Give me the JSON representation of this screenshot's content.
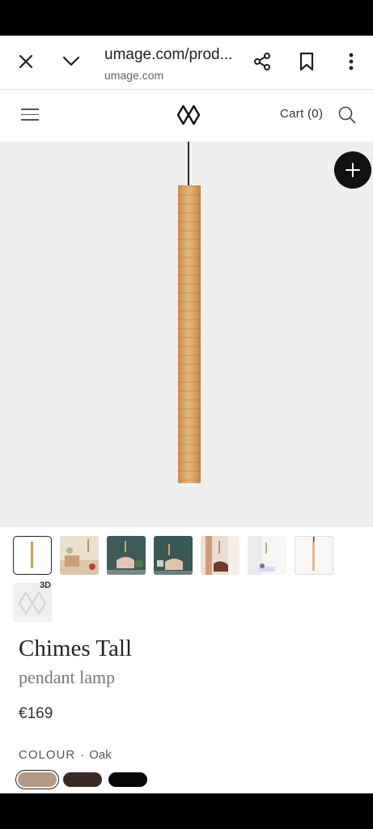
{
  "browser": {
    "url_main": "umage.com/prod...",
    "url_domain": "umage.com",
    "icons": [
      "close-icon",
      "chevron-down-icon",
      "share-icon",
      "bookmark-icon",
      "more-vert-icon"
    ]
  },
  "site_header": {
    "logo_name": "umage-logo",
    "cart_label": "Cart (0)"
  },
  "product": {
    "title": "Chimes Tall",
    "subtitle": "pendant lamp",
    "price": "€169",
    "colour_label": "COLOUR",
    "colour_separator": "·",
    "colour_value": "Oak",
    "swatches": [
      {
        "name": "Oak",
        "color": "#b39a86"
      },
      {
        "name": "Dark",
        "color": "#3b2a23"
      },
      {
        "name": "Black",
        "color": "#050505"
      }
    ],
    "thumb_3d_label": "3D",
    "accent_color": "#111111"
  }
}
